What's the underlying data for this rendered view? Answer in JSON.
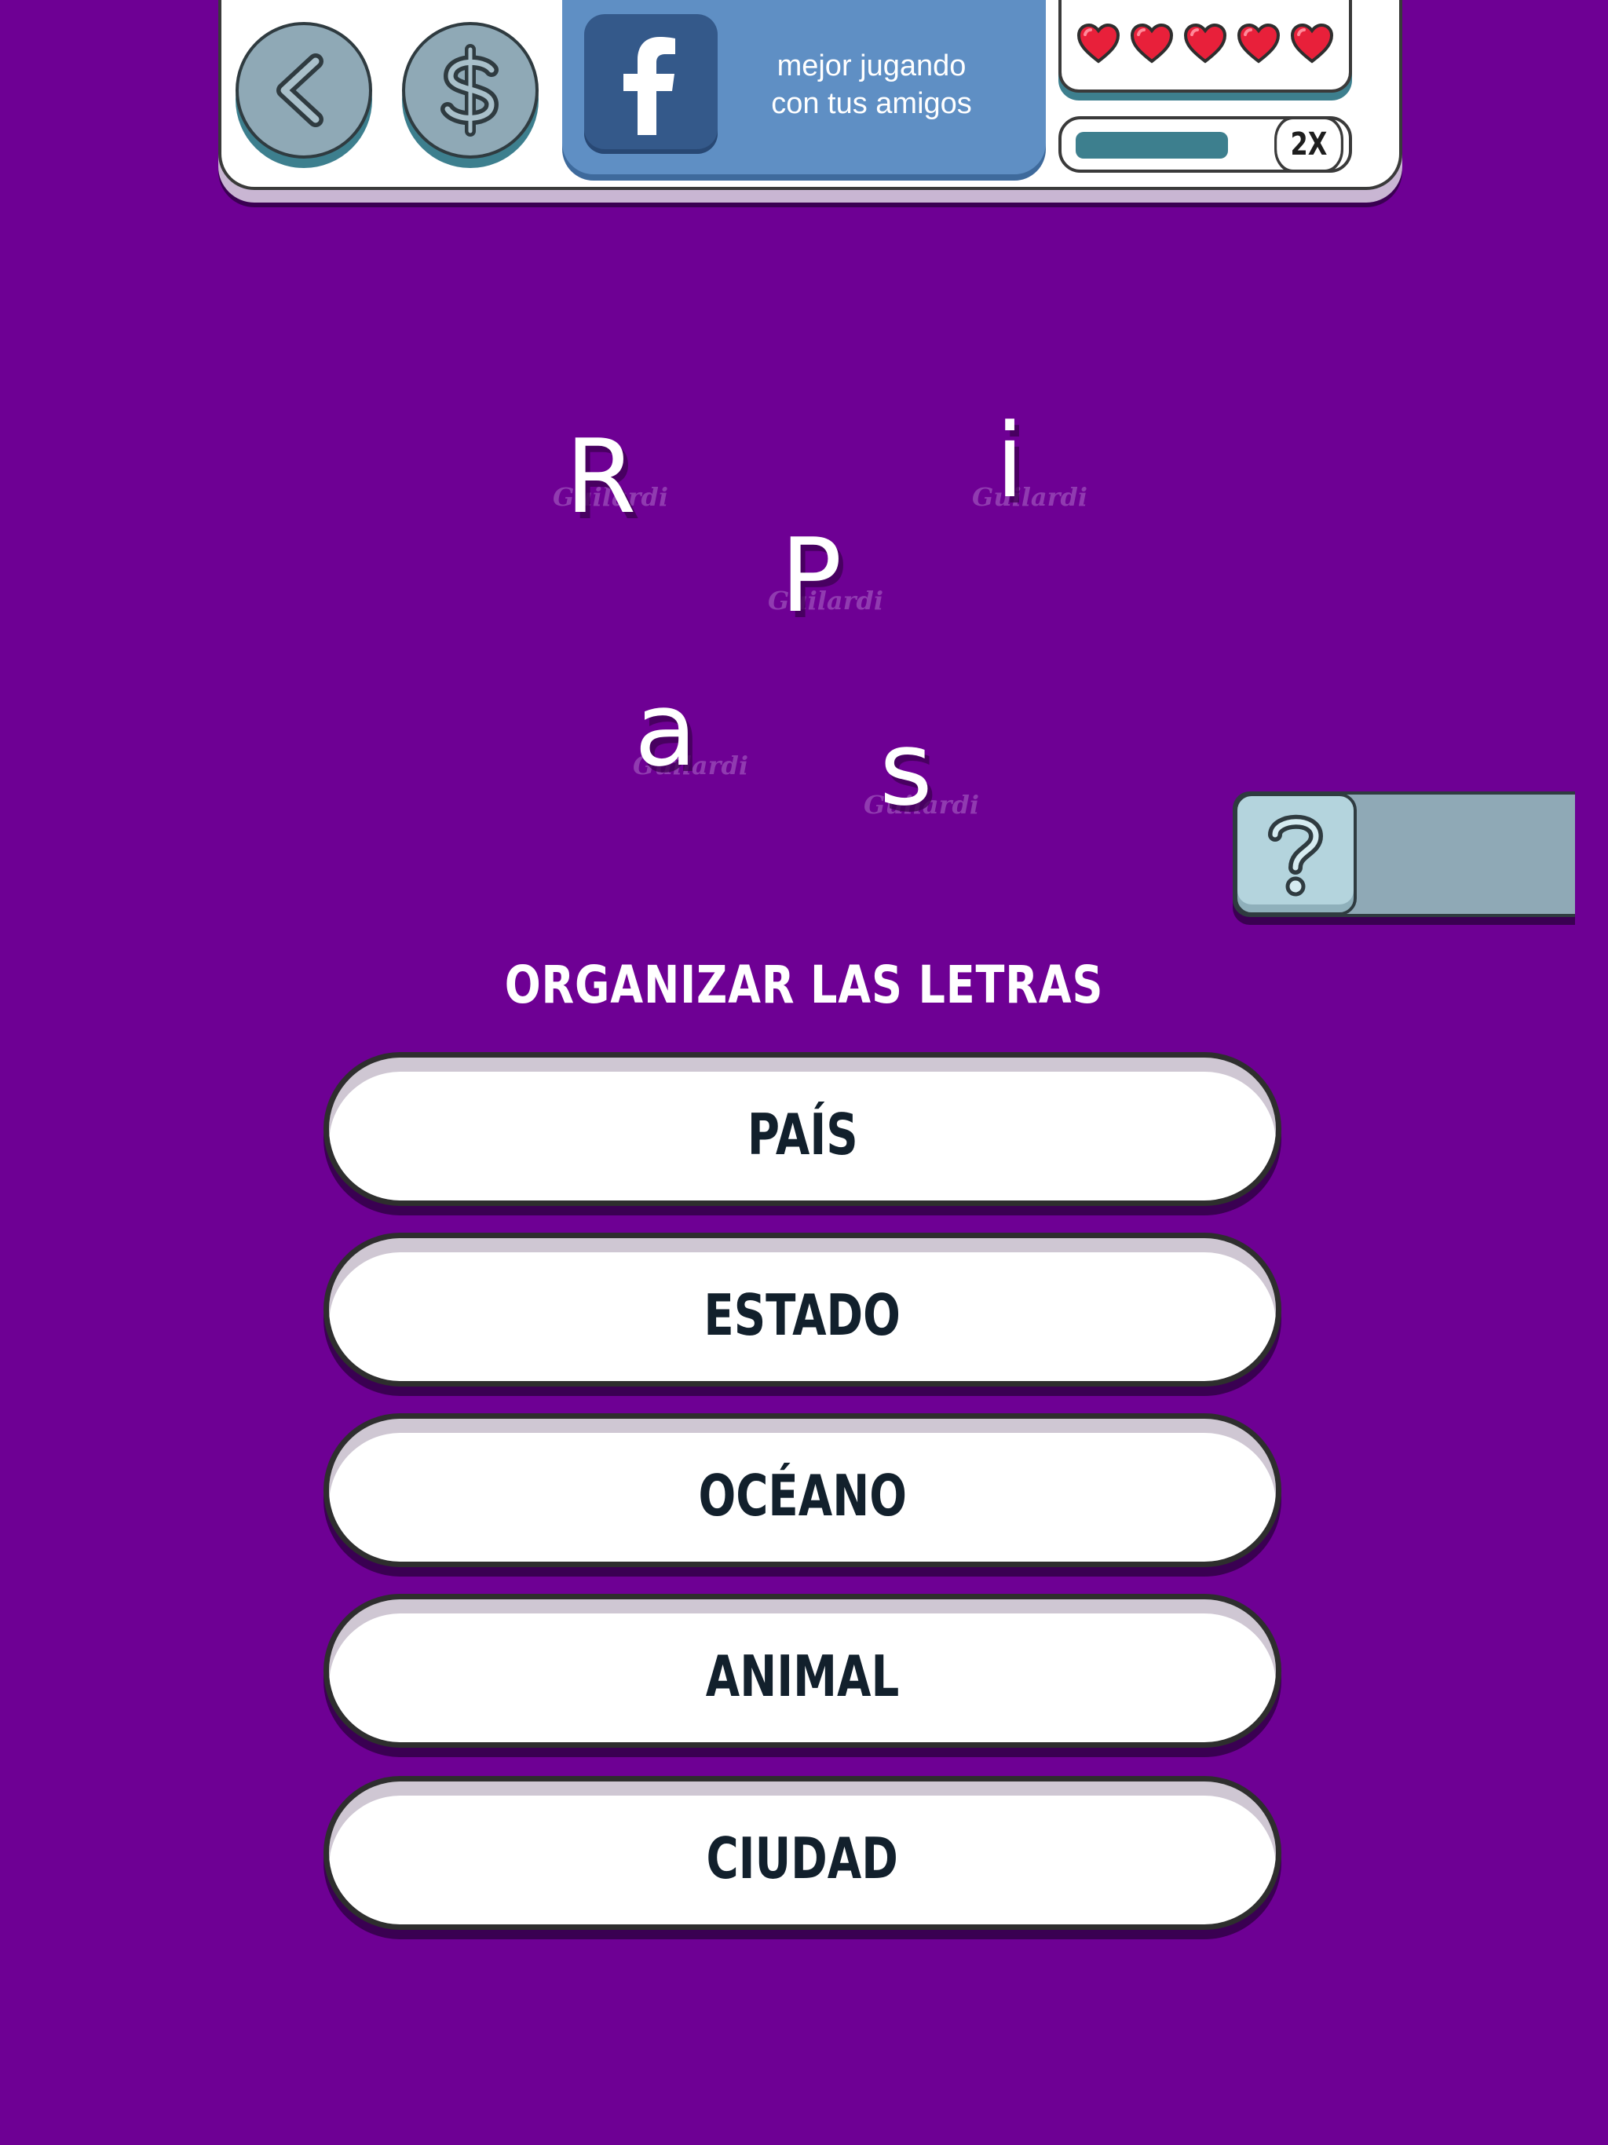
{
  "colors": {
    "background": "#6e0094",
    "panel": "#ffffff",
    "button_gray_blue": "#8fa9b6",
    "facebook": "#5f8fc4",
    "heart": "#e8203a",
    "multiplier_fill": "#3d7f8e"
  },
  "header": {
    "back_icon": "chevron-left-icon",
    "coins_icon": "dollar-icon",
    "facebook": {
      "icon": "facebook-icon",
      "text": "mejor jugando\ncon tus amigos"
    },
    "lives": {
      "count": 5,
      "icon": "heart-icon"
    },
    "multiplier": {
      "label": "2X",
      "progress": 0.7
    }
  },
  "puzzle": {
    "letters": [
      "R",
      "i",
      "P",
      "a",
      "s"
    ],
    "watermark": "Guilardi"
  },
  "hint": {
    "icon": "question-mark-icon"
  },
  "instruction": "ORGANIZAR LAS LETRAS",
  "options": [
    "PAÍS",
    "ESTADO",
    "OCÉANO",
    "ANIMAL",
    "CIUDAD"
  ]
}
